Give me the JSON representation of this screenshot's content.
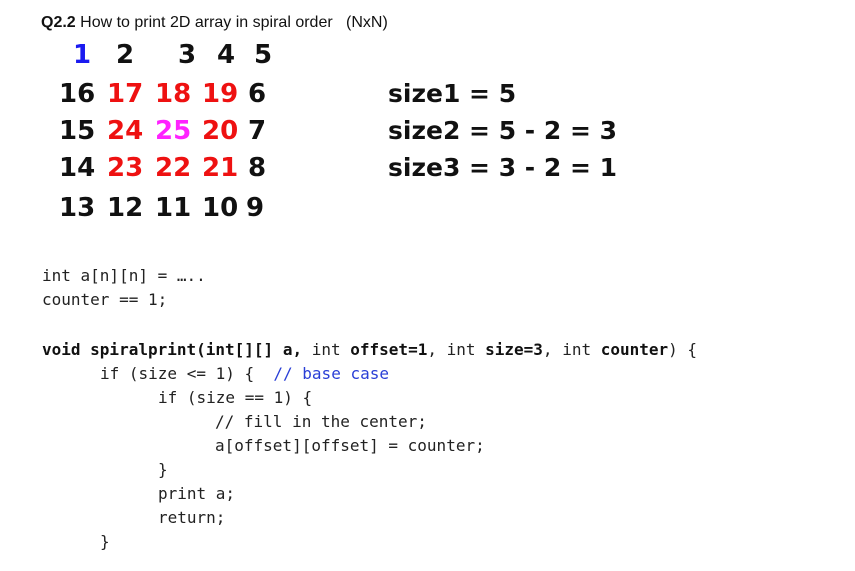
{
  "title": {
    "number": "Q2.2",
    "text": " How to print 2D array in spiral order   (NxN)"
  },
  "colors": {
    "black": "#111111",
    "blue": "#1a1af0",
    "red": "#ee1111",
    "magenta": "#ff22ff",
    "comment": "#2a3fd6"
  },
  "matrix": [
    [
      "1",
      "2",
      "3",
      "4",
      "5"
    ],
    [
      "16",
      "17",
      "18",
      "19",
      "6"
    ],
    [
      "15",
      "24",
      "25",
      "20",
      "7"
    ],
    [
      "14",
      "23",
      "22",
      "21",
      "8"
    ],
    [
      "13",
      "12",
      "11",
      "10",
      "9"
    ]
  ],
  "sizes": [
    "size1 = 5",
    "size2 = 5 - 2 = 3",
    "size3 = 3 - 2 = 1"
  ],
  "code": {
    "decl_array": "int a[n][n] = …..",
    "decl_counter": "counter == 1;",
    "sig_void": "void spiralprint(int[][] a,",
    "sig_int1": " int ",
    "sig_offset": "offset=1",
    "sig_comma1": ", int ",
    "sig_size": "size=3",
    "sig_comma2": ", int ",
    "sig_counter": "counter",
    "sig_end": ") {",
    "if_outer": "if (size <= 1) {  ",
    "comment_base": "// base case",
    "if_inner": "if (size == 1) {",
    "comment_fill": "// fill in the center;",
    "assign": "a[offset][offset] = counter;",
    "close_inner": "}",
    "print": "print a;",
    "ret": "return;",
    "close_outer": "}"
  }
}
